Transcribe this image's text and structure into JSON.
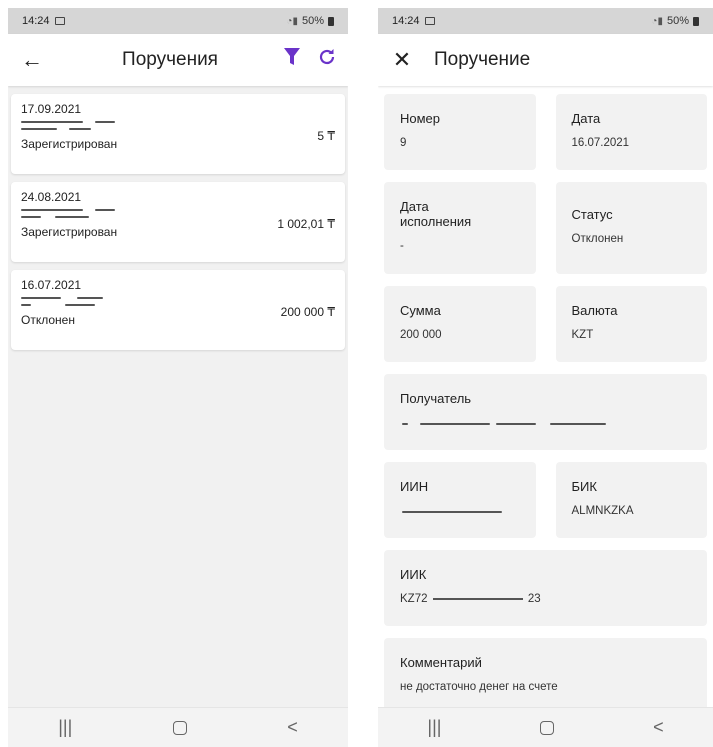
{
  "status_bar": {
    "time": "14:24",
    "battery": "50%"
  },
  "left_screen": {
    "title": "Поручения",
    "back_icon": "arrow-left-icon",
    "filter_icon": "filter-icon",
    "refresh_icon": "refresh-icon",
    "accent_color": "#6a33c9",
    "orders": [
      {
        "date": "17.09.2021",
        "amount": "5 ₸",
        "status": "Зарегистрирован"
      },
      {
        "date": "24.08.2021",
        "amount": "1 002,01 ₸",
        "status": "Зарегистрирован"
      },
      {
        "date": "16.07.2021",
        "amount": "200 000 ₸",
        "status": "Отклонен"
      }
    ]
  },
  "right_screen": {
    "title": "Поручение",
    "close_icon": "close-icon",
    "fields": {
      "number": {
        "label": "Номер",
        "value": "9"
      },
      "date": {
        "label": "Дата",
        "value": "16.07.2021"
      },
      "exec_date": {
        "label": "Дата исполнения",
        "value": "-"
      },
      "status": {
        "label": "Статус",
        "value": "Отклонен"
      },
      "amount": {
        "label": "Сумма",
        "value": "200 000"
      },
      "currency": {
        "label": "Валюта",
        "value": "KZT"
      },
      "recipient": {
        "label": "Получатель"
      },
      "iin": {
        "label": "ИИН"
      },
      "bik": {
        "label": "БИК",
        "value": "ALMNKZKA"
      },
      "iik": {
        "label": "ИИК",
        "value_start": "KZ72",
        "value_end": "23"
      },
      "comment": {
        "label": "Комментарий",
        "value": "не достаточно денег на счете"
      }
    }
  },
  "nav_bar": {
    "recents": "|||",
    "back": "<"
  }
}
